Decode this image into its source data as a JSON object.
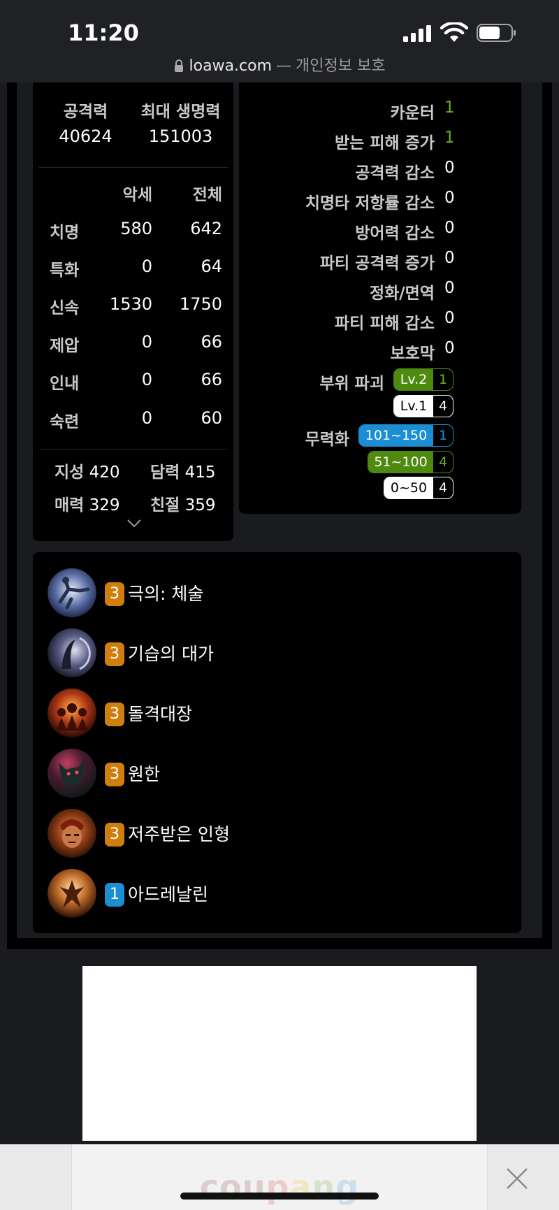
{
  "status": {
    "time": "11:20"
  },
  "browser": {
    "domain": "loawa.com",
    "separator": "—",
    "privacy": "개인정보 보호"
  },
  "stats": {
    "attack_label": "공격력",
    "attack_value": "40624",
    "hp_label": "최대 생명력",
    "hp_value": "151003",
    "col_gear": "악세",
    "col_total": "전체",
    "rows": [
      {
        "name": "치명",
        "gear": "580",
        "total": "642"
      },
      {
        "name": "특화",
        "gear": "0",
        "total": "64"
      },
      {
        "name": "신속",
        "gear": "1530",
        "total": "1750"
      },
      {
        "name": "제압",
        "gear": "0",
        "total": "66"
      },
      {
        "name": "인내",
        "gear": "0",
        "total": "66"
      },
      {
        "name": "숙련",
        "gear": "0",
        "total": "60"
      }
    ],
    "traits": [
      {
        "name": "지성",
        "value": "420"
      },
      {
        "name": "담력",
        "value": "415"
      },
      {
        "name": "매력",
        "value": "329"
      },
      {
        "name": "친절",
        "value": "359"
      }
    ]
  },
  "synergy": {
    "rows": [
      {
        "label": "카운터",
        "value": "1",
        "color": "#6ab024"
      },
      {
        "label": "받는 피해 증가",
        "value": "1",
        "color": "#6ab024"
      },
      {
        "label": "공격력 감소",
        "value": "0",
        "color": "#ffffff"
      },
      {
        "label": "치명타 저항률 감소",
        "value": "0",
        "color": "#ffffff"
      },
      {
        "label": "방어력 감소",
        "value": "0",
        "color": "#ffffff"
      },
      {
        "label": "파티 공격력 증가",
        "value": "0",
        "color": "#ffffff"
      },
      {
        "label": "정화/면역",
        "value": "0",
        "color": "#ffffff"
      },
      {
        "label": "파티 피해 감소",
        "value": "0",
        "color": "#ffffff"
      },
      {
        "label": "보호막",
        "value": "0",
        "color": "#ffffff"
      }
    ],
    "part_break": {
      "label": "부위 파괴",
      "badges": [
        {
          "level": "Lv.2",
          "count": "1",
          "color": "#4e8a10"
        },
        {
          "level": "Lv.1",
          "count": "4",
          "color": "#ffffff"
        }
      ]
    },
    "stagger": {
      "label": "무력화",
      "badges": [
        {
          "level": "101~150",
          "count": "1",
          "color": "#1c8fd4"
        },
        {
          "level": "51~100",
          "count": "4",
          "color": "#4e8a10"
        },
        {
          "level": "0~50",
          "count": "4",
          "color": "#ffffff"
        }
      ]
    }
  },
  "engravings": [
    {
      "level": "3",
      "name": "극의: 체술",
      "icon": "martial-arts-icon",
      "color": "#d17f0c"
    },
    {
      "level": "3",
      "name": "기습의 대가",
      "icon": "ambush-master-icon",
      "color": "#d17f0c"
    },
    {
      "level": "3",
      "name": "돌격대장",
      "icon": "raid-captain-icon",
      "color": "#d17f0c"
    },
    {
      "level": "3",
      "name": "원한",
      "icon": "grudge-icon",
      "color": "#d17f0c"
    },
    {
      "level": "3",
      "name": "저주받은 인형",
      "icon": "cursed-doll-icon",
      "color": "#d17f0c"
    },
    {
      "level": "1",
      "name": "아드레날린",
      "icon": "adrenaline-icon",
      "color": "#1c8fd4"
    }
  ],
  "ad": {
    "brand": "coupang"
  }
}
